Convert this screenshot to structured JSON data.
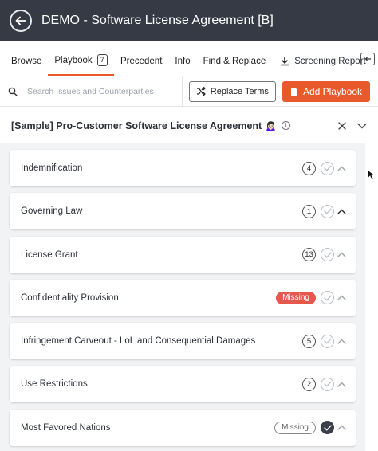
{
  "window": {
    "title": "DEMO - Software License Agreement [B]"
  },
  "tabs": [
    {
      "label": "Browse"
    },
    {
      "label": "Playbook",
      "badge": "7"
    },
    {
      "label": "Precedent"
    },
    {
      "label": "Info"
    },
    {
      "label": "Find & Replace"
    }
  ],
  "screening_report": {
    "label": "Screening Report"
  },
  "toolbar": {
    "search_placeholder": "Search Issues and Counterparties",
    "replace_label": "Replace Terms",
    "add_label": "Add Playbook"
  },
  "playbook": {
    "title": "[Sample] Pro-Customer Software License Agreement",
    "emoji": "🙍🏻‍♀️"
  },
  "issues": [
    {
      "label": "Indemnification",
      "count": "4",
      "status": "count",
      "checked": false
    },
    {
      "label": "Governing Law",
      "count": "1",
      "status": "count",
      "checked": false
    },
    {
      "label": "License Grant",
      "count": "13",
      "status": "count",
      "checked": false
    },
    {
      "label": "Confidentiality Provision",
      "badge": "Missing",
      "status": "missing-red",
      "checked": false
    },
    {
      "label": "Infringement Carveout - LoL and Consequential Damages",
      "count": "5",
      "status": "count",
      "checked": false
    },
    {
      "label": "Use Restrictions",
      "count": "2",
      "status": "count",
      "checked": false
    },
    {
      "label": "Most Favored Nations",
      "badge": "Missing",
      "status": "missing-outline",
      "checked": true
    }
  ],
  "colors": {
    "accent": "#e85a2b",
    "titlebar": "#353a45",
    "missing": "#e8574f"
  }
}
